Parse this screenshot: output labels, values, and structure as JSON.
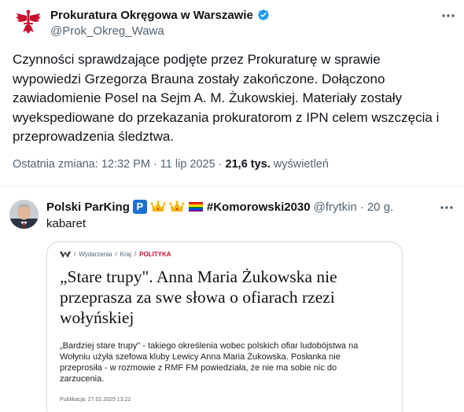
{
  "post": {
    "display_name": "Prokuratura Okręgowa w Warszawie",
    "handle": "@Prok_Okreg_Wawa",
    "text_lines": [
      "Czynności sprawdzające podjęte przez Prokuraturę w sprawie",
      "wypowiedzi Grzegorza Brauna zostały zakończone. Dołączono",
      "zawiadomienie Posel na Sejm A. M. Żukowskiej. Materiały  zostały",
      "wyekspediowane do przekazania prokuratorom z IPN celem wszczęcia i",
      "przeprowadzenia śledztwa."
    ],
    "meta_prefix": "Ostatnia zmiana: 12:32 PM · 11 lip 2025 · ",
    "views_count": "21,6 tys.",
    "views_label": " wyświetleń",
    "colors": {
      "verified": "#1d9bf0",
      "logo": "#c8102e"
    }
  },
  "reply": {
    "display_name": "Polski ParKing",
    "emoji_p": "P",
    "hashtag": "#Komorowski2030",
    "handle": "@frytkin",
    "separator": "·",
    "time": "20 g.",
    "text": "kabaret",
    "card": {
      "crumb_section": "Wydarzenia",
      "crumb_sub": "Kraj",
      "crumb_category": "POLITYKA",
      "title_lines": [
        "„Stare trupy\". Anna Maria Żukowska nie",
        "przeprasza za swe słowa o ofiarach rzezi",
        "wołyńskiej"
      ],
      "lead_lines": [
        "„Bardziej stare trupy\" - takiego określenia wobec polskich ofiar ludobójstwa na",
        "Wołyniu użyła szefowa kluby Lewicy Anna Maria Żukowska. Posłanka nie",
        "przeprosiła - w rozmowie z RMF FM powiedziała, że nie ma sobie nic do",
        "zarzucenia."
      ],
      "date": "Publikacja: 27.02.2025 13:22"
    }
  },
  "icons": {
    "main_avatar": "prosecutor-eagle-logo-icon",
    "verified": "verified-badge-icon",
    "more": "more-dots-icon",
    "crown": "crown-emoji-icon",
    "rainbow": "rainbow-flag-emoji-icon"
  }
}
